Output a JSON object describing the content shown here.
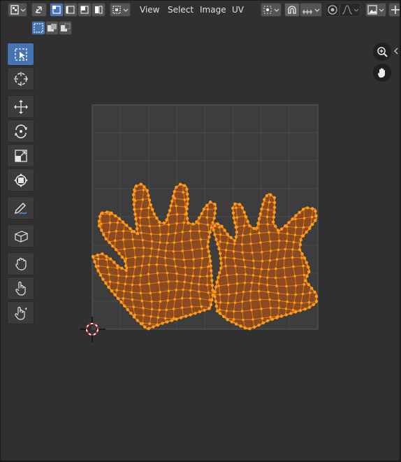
{
  "header": {
    "menus": [
      "View",
      "Select",
      "Image",
      "UV"
    ]
  },
  "colors": {
    "accent": "#4772b3",
    "mesh_face": "#8a4a22",
    "mesh_edge": "#ff8c00",
    "background": "#303030"
  },
  "icons": {
    "editor_type": "uv-editor-icon",
    "sync_selection": "sync-selection-icon",
    "select_modes": [
      "vertex-select-icon",
      "edge-select-icon",
      "face-select-icon",
      "island-select-icon"
    ],
    "sticky_mode": "sticky-selection-icon",
    "pivot": "pivot-point-icon",
    "snap": "snap-icon",
    "snap_target": "snap-increment-icon",
    "proportional": "proportional-edit-icon",
    "falloff": "falloff-curve-icon",
    "image_browse": "image-browse-icon",
    "new_image": "new-image-icon",
    "select_box_modes": [
      "select-new-icon",
      "select-extend-icon",
      "select-subtract-icon"
    ],
    "tools": [
      "select-box-icon",
      "cursor-icon",
      "move-icon",
      "rotate-icon",
      "scale-icon",
      "transform-icon",
      "annotate-icon",
      "rip-icon",
      "grab-icon",
      "relax-icon",
      "pinch-icon"
    ],
    "nav": [
      "zoom-icon",
      "pan-hand-icon"
    ]
  }
}
